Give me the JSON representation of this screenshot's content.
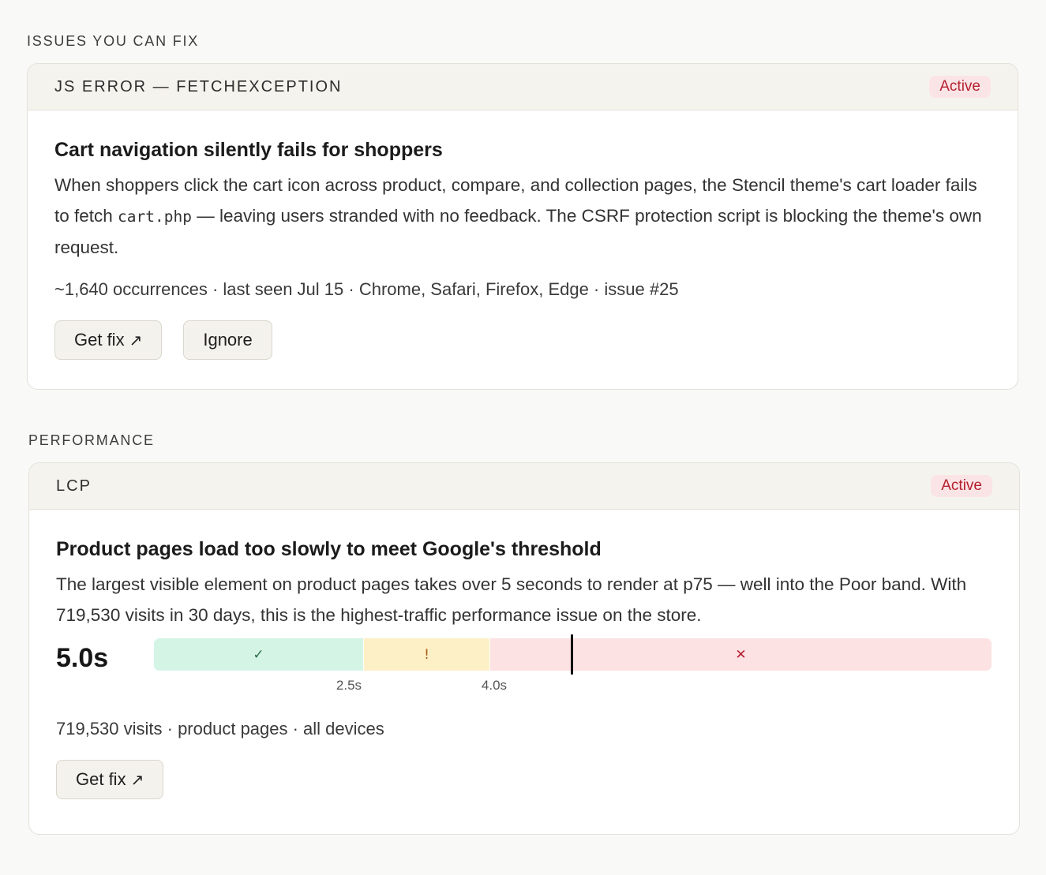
{
  "sections": {
    "issues_label": "ISSUES YOU CAN FIX",
    "performance_label": "PERFORMANCE"
  },
  "js_card": {
    "kicker": "JS ERROR — FETCHEXCEPTION",
    "status": "Active",
    "title": "Cart navigation silently fails for shoppers",
    "desc_part1": "When shoppers click the cart icon across product, compare, and collection pages, the Stencil theme's cart loader fails to fetch ",
    "desc_code": "cart.php",
    "desc_part2": " — leaving users stranded with no feedback. The CSRF protection script is blocking the theme's own request.",
    "meta": "~1,640 occurrences · last seen Jul 15 · Chrome, Safari, Firefox, Edge · issue #25",
    "get_fix_label": "Get fix",
    "ignore_label": "Ignore"
  },
  "lcp_card": {
    "kicker": "LCP",
    "status": "Active",
    "title": "Product pages load too slowly to meet Google's threshold",
    "desc": "The largest visible element on product pages takes over 5 seconds to render at p75 — well into the Poor band. With 719,530 visits in 30 days, this is the highest-traffic performance issue on the store.",
    "gauge": {
      "value_label": "5.0s",
      "value": 5.0,
      "scale_max": 10.0,
      "thresholds": [
        2.5,
        4.0
      ],
      "tick_good": "2.5s",
      "tick_poor": "4.0s",
      "good_symbol": "✓",
      "mid_symbol": "!",
      "poor_symbol": "✕",
      "good_color": "#d4f5e6",
      "mid_color": "#fdf0c7",
      "poor_color": "#fde2e4"
    },
    "meta": "719,530 visits · product pages · all devices",
    "get_fix_label": "Get fix"
  },
  "icons": {
    "external_arrow": "↗"
  },
  "colors": {
    "badge_bg": "#fbe4e6",
    "badge_text": "#b5202e"
  }
}
